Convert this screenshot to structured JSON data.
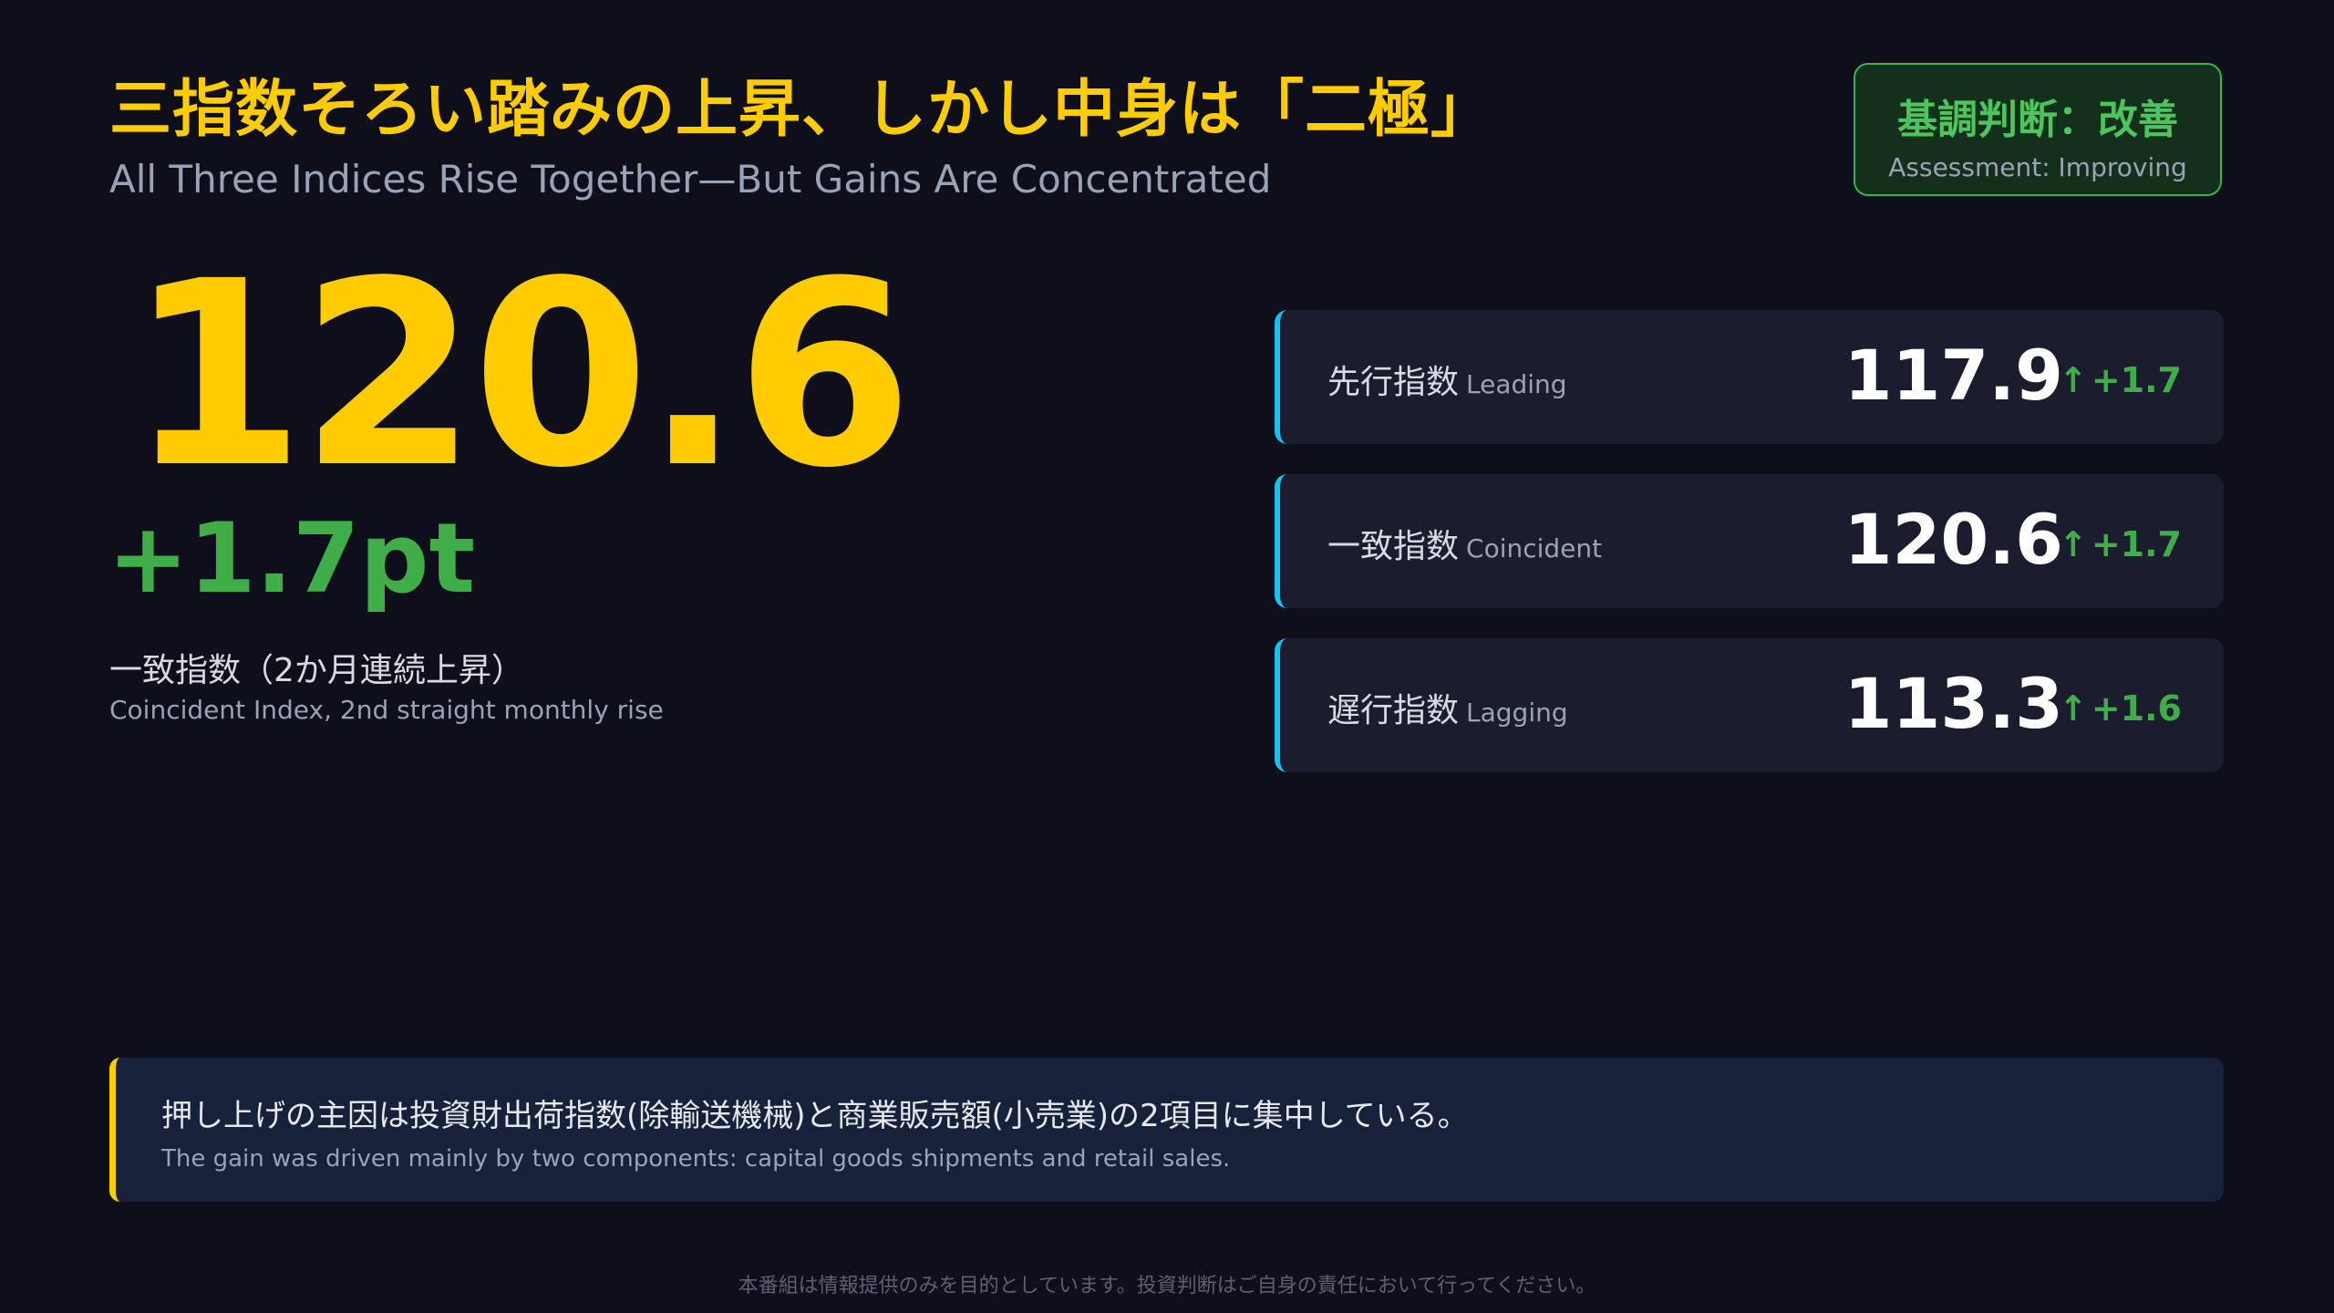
{
  "header": {
    "title": "三指数そろい踏みの上昇、しかし中身は「二極」",
    "subtitle": "All Three Indices Rise Together—But Gains Are Concentrated"
  },
  "assessment": {
    "label_jp": "基調判断：改善",
    "label_en": "Assessment: Improving"
  },
  "hero": {
    "value": "120.6",
    "change": "+1.7pt",
    "label_jp": "一致指数（2か月連続上昇）",
    "label_en": "Coincident Index, 2nd straight monthly rise"
  },
  "indices": [
    {
      "label_jp": "先行指数",
      "label_en": "Leading",
      "value": "117.9",
      "arrow": "↑",
      "change": "+1.7"
    },
    {
      "label_jp": "一致指数",
      "label_en": "Coincident",
      "value": "120.6",
      "arrow": "↑",
      "change": "+1.7"
    },
    {
      "label_jp": "遅行指数",
      "label_en": "Lagging",
      "value": "113.3",
      "arrow": "↑",
      "change": "+1.6"
    }
  ],
  "callout": {
    "text_jp": "押し上げの主因は投資財出荷指数(除輸送機械)と商業販売額(小売業)の2項目に集中している。",
    "text_en": "The gain was driven mainly by two components: capital goods shipments and retail sales."
  },
  "footer": {
    "disclaimer": "本番組は情報提供のみを目的としています。投資判断はご自身の責任において行ってください。"
  },
  "colors": {
    "background": "#0f0f1c",
    "accent_yellow": "#ffcc00",
    "positive_green": "#3fae49",
    "card_accent_cyan": "#16c3ee"
  }
}
